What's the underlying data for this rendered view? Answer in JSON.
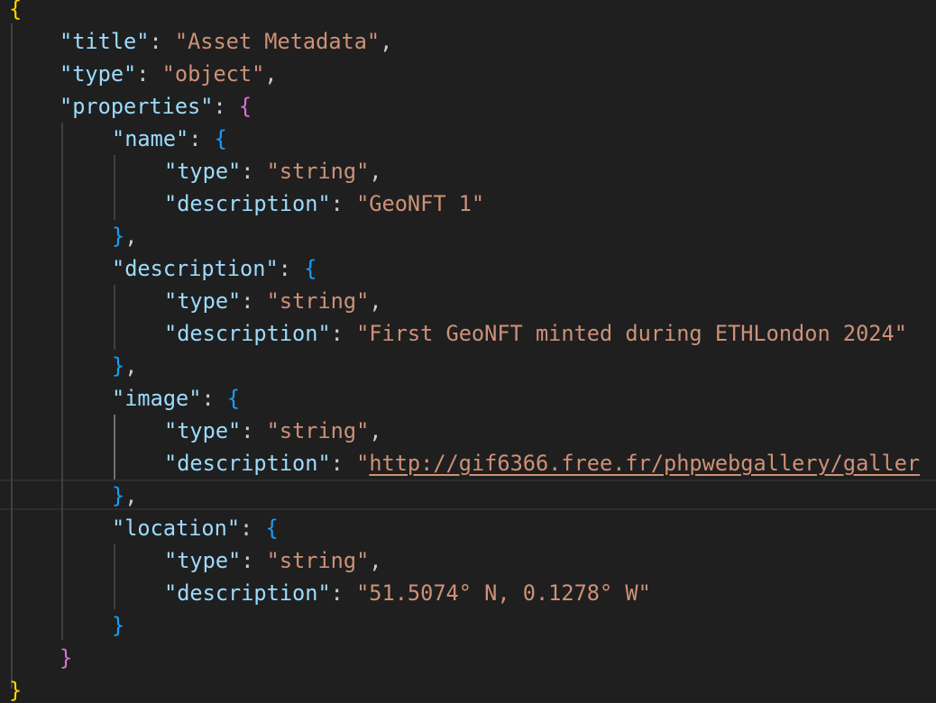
{
  "colors": {
    "background": "#1f1f1f",
    "key": "#9cdcfe",
    "string": "#ce9178",
    "punctuation": "#cccccc",
    "bracket_level_1": "#ffd700",
    "bracket_level_2": "#da70d6",
    "bracket_level_3": "#179fff",
    "indent_guide": "#404040"
  },
  "lines": [
    {
      "tokens": [
        {
          "t": "{",
          "c": "b1"
        }
      ]
    },
    {
      "tokens": [
        {
          "t": "\"title\"",
          "c": "key"
        },
        {
          "t": ": ",
          "c": "punc"
        },
        {
          "t": "\"Asset Metadata\"",
          "c": "str"
        },
        {
          "t": ",",
          "c": "punc"
        }
      ]
    },
    {
      "tokens": [
        {
          "t": "\"type\"",
          "c": "key"
        },
        {
          "t": ": ",
          "c": "punc"
        },
        {
          "t": "\"object\"",
          "c": "str"
        },
        {
          "t": ",",
          "c": "punc"
        }
      ]
    },
    {
      "tokens": [
        {
          "t": "\"properties\"",
          "c": "key"
        },
        {
          "t": ": ",
          "c": "punc"
        },
        {
          "t": "{",
          "c": "b2"
        }
      ]
    },
    {
      "tokens": [
        {
          "t": "\"name\"",
          "c": "key"
        },
        {
          "t": ": ",
          "c": "punc"
        },
        {
          "t": "{",
          "c": "b3"
        }
      ]
    },
    {
      "tokens": [
        {
          "t": "\"type\"",
          "c": "key"
        },
        {
          "t": ": ",
          "c": "punc"
        },
        {
          "t": "\"string\"",
          "c": "str"
        },
        {
          "t": ",",
          "c": "punc"
        }
      ]
    },
    {
      "tokens": [
        {
          "t": "\"description\"",
          "c": "key"
        },
        {
          "t": ": ",
          "c": "punc"
        },
        {
          "t": "\"GeoNFT 1\"",
          "c": "str"
        }
      ]
    },
    {
      "tokens": [
        {
          "t": "}",
          "c": "b3"
        },
        {
          "t": ",",
          "c": "punc"
        }
      ]
    },
    {
      "tokens": [
        {
          "t": "\"description\"",
          "c": "key"
        },
        {
          "t": ": ",
          "c": "punc"
        },
        {
          "t": "{",
          "c": "b3"
        }
      ]
    },
    {
      "tokens": [
        {
          "t": "\"type\"",
          "c": "key"
        },
        {
          "t": ": ",
          "c": "punc"
        },
        {
          "t": "\"string\"",
          "c": "str"
        },
        {
          "t": ",",
          "c": "punc"
        }
      ]
    },
    {
      "tokens": [
        {
          "t": "\"description\"",
          "c": "key"
        },
        {
          "t": ": ",
          "c": "punc"
        },
        {
          "t": "\"First GeoNFT minted during ETHLondon 2024\"",
          "c": "str"
        }
      ]
    },
    {
      "tokens": [
        {
          "t": "}",
          "c": "b3"
        },
        {
          "t": ",",
          "c": "punc"
        }
      ]
    },
    {
      "tokens": [
        {
          "t": "\"image\"",
          "c": "key"
        },
        {
          "t": ": ",
          "c": "punc"
        },
        {
          "t": "{",
          "c": "b3"
        }
      ]
    },
    {
      "tokens": [
        {
          "t": "\"type\"",
          "c": "key"
        },
        {
          "t": ": ",
          "c": "punc"
        },
        {
          "t": "\"string\"",
          "c": "str"
        },
        {
          "t": ",",
          "c": "punc"
        }
      ]
    },
    {
      "tokens": [
        {
          "t": "\"description\"",
          "c": "key"
        },
        {
          "t": ": ",
          "c": "punc"
        },
        {
          "t": "\"",
          "c": "str"
        },
        {
          "t": "http://gif6366.free.fr/phpwebgallery/galler",
          "c": "str link"
        }
      ]
    },
    {
      "tokens": [
        {
          "t": "}",
          "c": "b3"
        },
        {
          "t": ",",
          "c": "punc"
        }
      ]
    },
    {
      "tokens": [
        {
          "t": "\"location\"",
          "c": "key"
        },
        {
          "t": ": ",
          "c": "punc"
        },
        {
          "t": "{",
          "c": "b3"
        }
      ]
    },
    {
      "tokens": [
        {
          "t": "\"type\"",
          "c": "key"
        },
        {
          "t": ": ",
          "c": "punc"
        },
        {
          "t": "\"string\"",
          "c": "str"
        },
        {
          "t": ",",
          "c": "punc"
        }
      ]
    },
    {
      "tokens": [
        {
          "t": "\"description\"",
          "c": "key"
        },
        {
          "t": ": ",
          "c": "punc"
        },
        {
          "t": "\"51.5074° N, 0.1278° W\"",
          "c": "str"
        }
      ]
    },
    {
      "tokens": [
        {
          "t": "}",
          "c": "b3"
        }
      ]
    },
    {
      "tokens": [
        {
          "t": "}",
          "c": "b2"
        }
      ]
    },
    {
      "tokens": [
        {
          "t": "}",
          "c": "b1"
        }
      ]
    }
  ]
}
